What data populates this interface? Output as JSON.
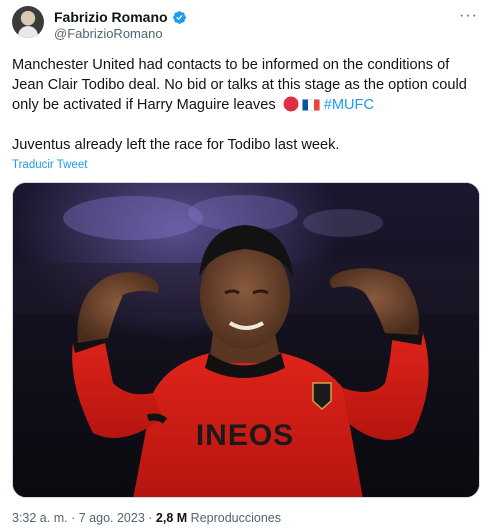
{
  "author": {
    "name": "Fabrizio Romano",
    "handle": "@FabrizioRomano",
    "verified_color": "#1d9bf0"
  },
  "tweet": {
    "text_part1": "Manchester United had contacts to be informed on the conditions of Jean Clair Todibo deal. No bid or talks at this stage as the option could only be activated if Harry Maguire leaves ",
    "emoji": [
      "red-circle",
      "flag-france"
    ],
    "hashtag": "#MUFC",
    "text_part2": "Juventus already left the race for Todibo last week.",
    "translate_label": "Traducir Tweet"
  },
  "media": {
    "alt": "photo",
    "shirt_text": "INEOS"
  },
  "footer": {
    "time": "3:32 a. m.",
    "separator": "·",
    "date": "7 ago. 2023",
    "views_count": "2,8 M",
    "views_label": "Reproducciones"
  },
  "icons": {
    "more": "more-options-icon",
    "verified": "verified-badge-icon"
  },
  "colors": {
    "link": "#1d9bf0",
    "secondary_text": "#536471",
    "primary_text": "#0f1419",
    "jersey_red": "#e0241b"
  }
}
